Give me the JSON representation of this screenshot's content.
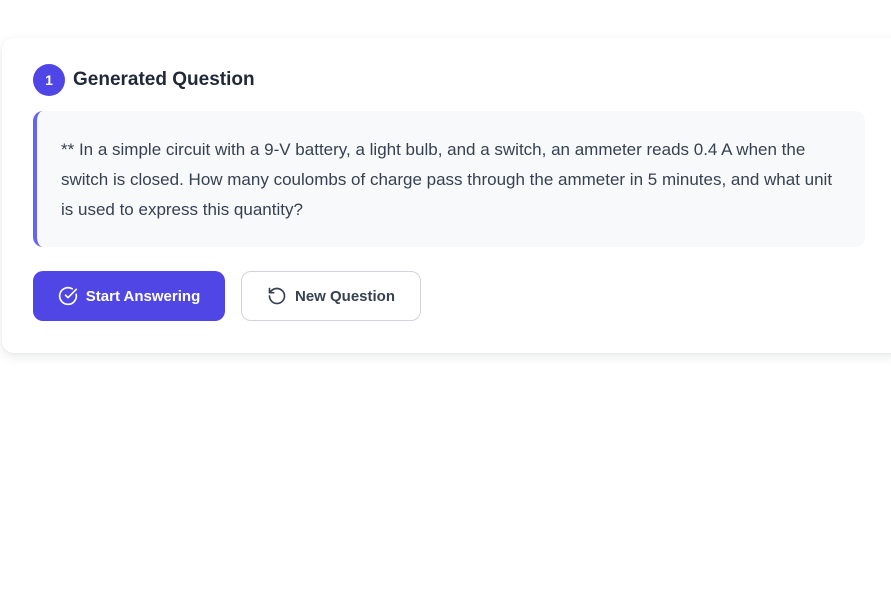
{
  "step": {
    "number": "1",
    "title": "Generated Question"
  },
  "question": {
    "text": "** In a simple circuit with a 9-V battery, a light bulb, and a switch, an ammeter reads 0.4 A when the switch is closed. How many coulombs of charge pass through the ammeter in 5 minutes, and what unit is used to express this quantity?"
  },
  "actions": {
    "start_label": "Start Answering",
    "start_icon": "check-circle-icon",
    "new_label": "New Question",
    "new_icon": "rotate-ccw-icon"
  },
  "colors": {
    "accent": "#4f46e5",
    "accent_border": "#6366f1",
    "question_bg": "#f8f9fb"
  }
}
